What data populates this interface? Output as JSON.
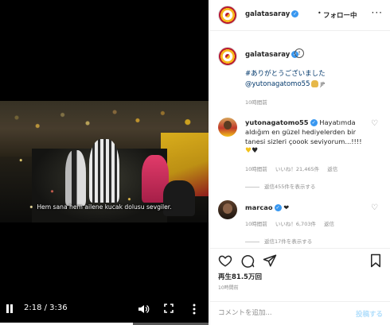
{
  "video": {
    "subtitle": "Hem sana hem ailene kucak dolusu sevgiler.",
    "time": "2:18 / 3:36",
    "progress": 0.639
  },
  "header": {
    "username": "galatasaray",
    "separator": "•",
    "follow_status": "フォロー中",
    "more": "···"
  },
  "caption": {
    "username": "galatasaray",
    "emoji": "😱",
    "hashtag": "#ありがとうございました",
    "mention": "@yutonagatomo55",
    "lang": "JP",
    "timestamp": "10時間前"
  },
  "comments": [
    {
      "username": "yutonagatomo55",
      "text": "Hayatımda aldığım en güzel hediyelerden bir tanesi sizleri çoook seviyorum...!!!!",
      "hearts": "💛🖤",
      "time": "10時間前",
      "likes": "いいね！21,465件",
      "reply": "返信",
      "view_replies": "返信455件を表示する"
    },
    {
      "username": "marcao",
      "text": "❤",
      "time": "10時間前",
      "likes": "いいね！6,703件",
      "reply": "返信",
      "view_replies": "返信17件を表示する"
    }
  ],
  "stats": {
    "views": "再生81.5万回",
    "timestamp": "10時間前"
  },
  "comment_box": {
    "placeholder": "コメントを追加...",
    "post_label": "投稿する"
  },
  "icons": {
    "play_state": "pause-icon",
    "volume": "volume-icon",
    "fullscreen": "fullscreen-icon",
    "more": "more-icon",
    "like": "heart-icon",
    "comment": "comment-icon",
    "share": "share-icon",
    "save": "bookmark-icon",
    "verified_color": "#3897f0"
  }
}
